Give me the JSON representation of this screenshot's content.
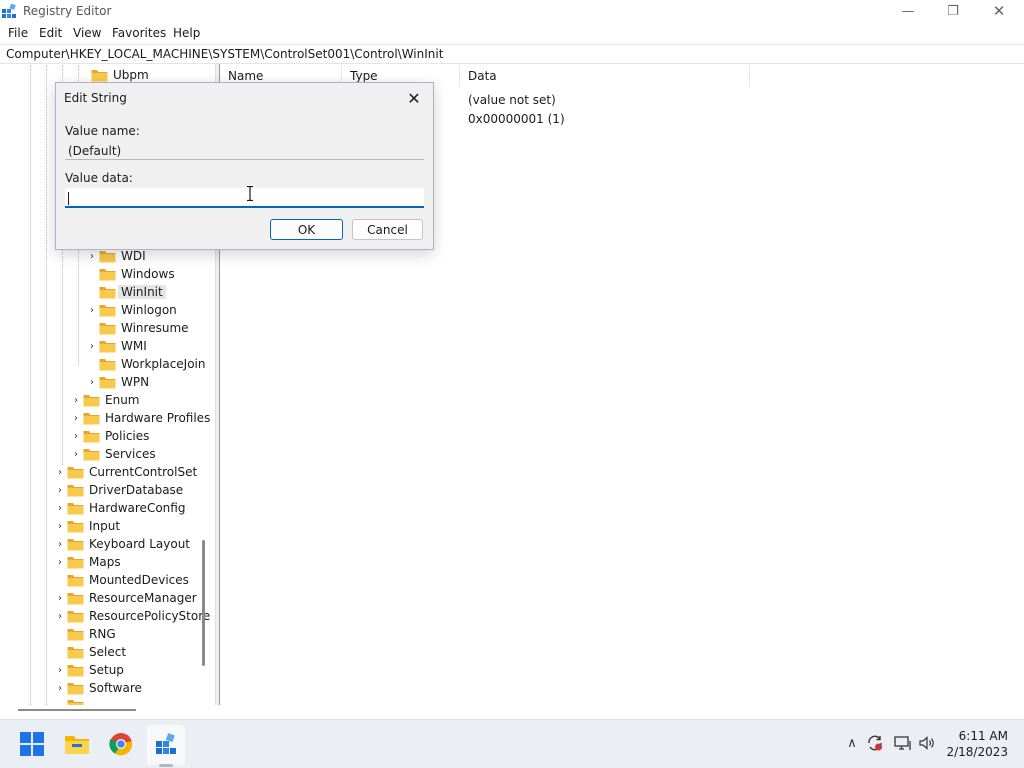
{
  "window": {
    "title": "Registry Editor",
    "minimize_glyph": "—",
    "maximize_glyph": "❐",
    "close_glyph": "✕"
  },
  "menu": {
    "file": "File",
    "edit": "Edit",
    "view": "View",
    "favorites": "Favorites",
    "help": "Help"
  },
  "address": {
    "path": "Computer\\HKEY_LOCAL_MACHINE\\SYSTEM\\ControlSet001\\Control\\WinInit"
  },
  "tree": {
    "items": [
      {
        "label": "Ubpm",
        "expander": ""
      },
      {
        "label": "WDI",
        "expander": "›"
      },
      {
        "label": "Windows",
        "expander": ""
      },
      {
        "label": "WinInit",
        "expander": ""
      },
      {
        "label": "Winlogon",
        "expander": "›"
      },
      {
        "label": "Winresume",
        "expander": ""
      },
      {
        "label": "WMI",
        "expander": "›"
      },
      {
        "label": "WorkplaceJoin",
        "expander": ""
      },
      {
        "label": "WPN",
        "expander": "›"
      },
      {
        "label": "Enum",
        "expander": "›"
      },
      {
        "label": "Hardware Profiles",
        "expander": "›"
      },
      {
        "label": "Policies",
        "expander": "›"
      },
      {
        "label": "Services",
        "expander": "›"
      },
      {
        "label": "CurrentControlSet",
        "expander": "›"
      },
      {
        "label": "DriverDatabase",
        "expander": "›"
      },
      {
        "label": "HardwareConfig",
        "expander": "›"
      },
      {
        "label": "Input",
        "expander": "›"
      },
      {
        "label": "Keyboard Layout",
        "expander": "›"
      },
      {
        "label": "Maps",
        "expander": "›"
      },
      {
        "label": "MountedDevices",
        "expander": ""
      },
      {
        "label": "ResourceManager",
        "expander": "›"
      },
      {
        "label": "ResourcePolicyStore",
        "expander": "›"
      },
      {
        "label": "RNG",
        "expander": ""
      },
      {
        "label": "Select",
        "expander": ""
      },
      {
        "label": "Setup",
        "expander": "›"
      },
      {
        "label": "Software",
        "expander": "›"
      }
    ]
  },
  "list": {
    "columns": {
      "name": "Name",
      "type": "Type",
      "data": "Data"
    },
    "rows": [
      {
        "data": "(value not set)"
      },
      {
        "data": "0x00000001 (1)"
      }
    ]
  },
  "dialog": {
    "title": "Edit String",
    "close_glyph": "✕",
    "value_name_label": "Value name:",
    "value_name": "(Default)",
    "value_data_label": "Value data:",
    "value_data": "",
    "ok_label": "OK",
    "cancel_label": "Cancel"
  },
  "taskbar": {
    "clock_time": "6:11 AM",
    "clock_date": "2/18/2023",
    "tray_chevron": "∧"
  },
  "colors": {
    "accent": "#0067c0",
    "folder": "#f8c94a",
    "folder_dark": "#e3a92b",
    "taskbar": "#ebeff5"
  }
}
